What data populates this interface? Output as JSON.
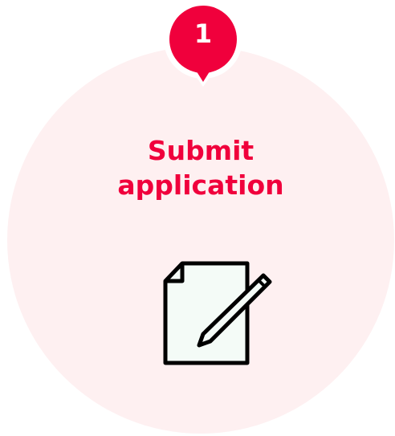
{
  "step": {
    "number": "1",
    "title_line1": "Submit",
    "title_line2": "application",
    "icon": "document-pen-icon",
    "accent_color": "#f0003c",
    "circle_color": "#fef0f1"
  }
}
